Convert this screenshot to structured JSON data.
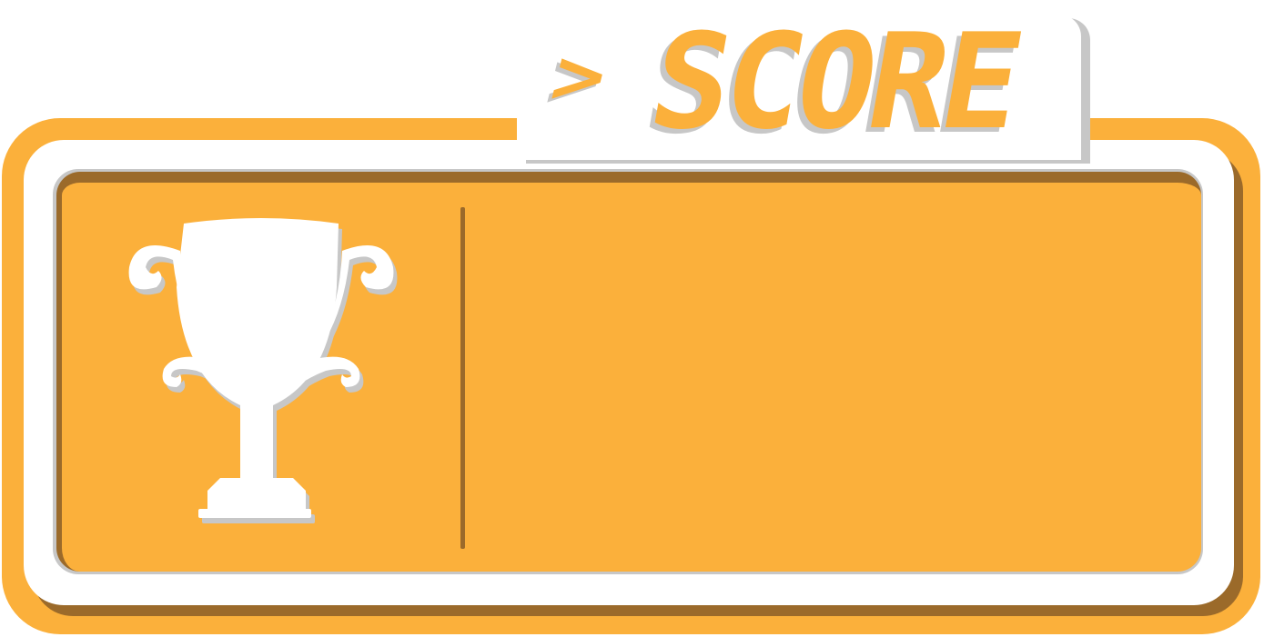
{
  "title": {
    "arrow": ">",
    "label": "SCORE"
  },
  "score": {
    "value": ""
  },
  "icons": {
    "trophy": "trophy-icon"
  },
  "colors": {
    "accent": "#fbb03b",
    "shadow_brown": "#9b6a2a",
    "shadow_grey": "#c7c7c7",
    "trophy": "#ffffff"
  }
}
